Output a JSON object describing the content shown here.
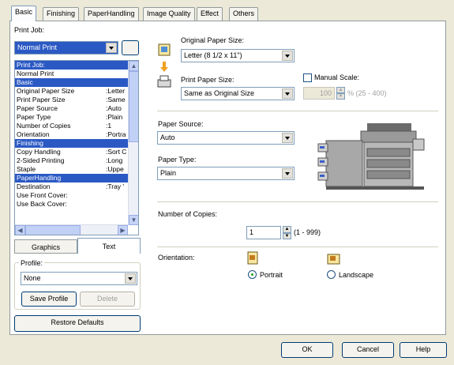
{
  "tabs": [
    {
      "label": "Basic"
    },
    {
      "label": "Finishing"
    },
    {
      "label": "PaperHandling"
    },
    {
      "label": "Image Quality"
    },
    {
      "label": "Effect"
    },
    {
      "label": "Others"
    }
  ],
  "print_job": {
    "label": "Print Job:",
    "value": "Normal Print"
  },
  "settings_list": [
    {
      "name": "Print Job:",
      "value": "",
      "header": true
    },
    {
      "name": "Normal Print",
      "value": "",
      "header": false
    },
    {
      "name": "Basic",
      "value": "",
      "header": true
    },
    {
      "name": "Original Paper Size",
      "value": ":Letter",
      "header": false
    },
    {
      "name": "Print Paper Size",
      "value": ":Same",
      "header": false
    },
    {
      "name": "Paper Source",
      "value": ":Auto",
      "header": false
    },
    {
      "name": "Paper Type",
      "value": ":Plain",
      "header": false
    },
    {
      "name": "Number of Copies",
      "value": ":1",
      "header": false
    },
    {
      "name": "Orientation",
      "value": ":Portra",
      "header": false
    },
    {
      "name": "Finishing",
      "value": "",
      "header": true
    },
    {
      "name": "Copy Handling",
      "value": ":Sort C",
      "header": false
    },
    {
      "name": "2-Sided Printing",
      "value": ":Long",
      "header": false
    },
    {
      "name": "Staple",
      "value": ":Uppe",
      "header": false
    },
    {
      "name": "PaperHandling",
      "value": "",
      "header": true
    },
    {
      "name": "Destination",
      "value": ":Tray '",
      "header": false
    },
    {
      "name": "Use Front Cover:",
      "value": "",
      "header": false
    },
    {
      "name": "Use Back Cover:",
      "value": "",
      "header": false
    }
  ],
  "view_tabs": {
    "graphics": "Graphics",
    "text": "Text"
  },
  "profile": {
    "label": "Profile:",
    "value": "None",
    "save_label": "Save Profile",
    "delete_label": "Delete"
  },
  "restore_defaults_label": "Restore Defaults",
  "original_paper_size": {
    "label": "Original Paper Size:",
    "value": "Letter (8 1/2 x 11\")"
  },
  "print_paper_size": {
    "label": "Print Paper Size:",
    "value": "Same as Original Size"
  },
  "manual_scale": {
    "label": "Manual Scale:",
    "value": "100",
    "range": "% (25 - 400)"
  },
  "paper_source": {
    "label": "Paper Source:",
    "value": "Auto"
  },
  "paper_type": {
    "label": "Paper Type:",
    "value": "Plain"
  },
  "copies": {
    "label": "Number of Copies:",
    "value": "1",
    "range": "(1 - 999)"
  },
  "orientation": {
    "label": "Orientation:",
    "portrait": "Portrait",
    "landscape": "Landscape",
    "selected": "portrait"
  },
  "footer": {
    "ok": "OK",
    "cancel": "Cancel",
    "help": "Help"
  }
}
